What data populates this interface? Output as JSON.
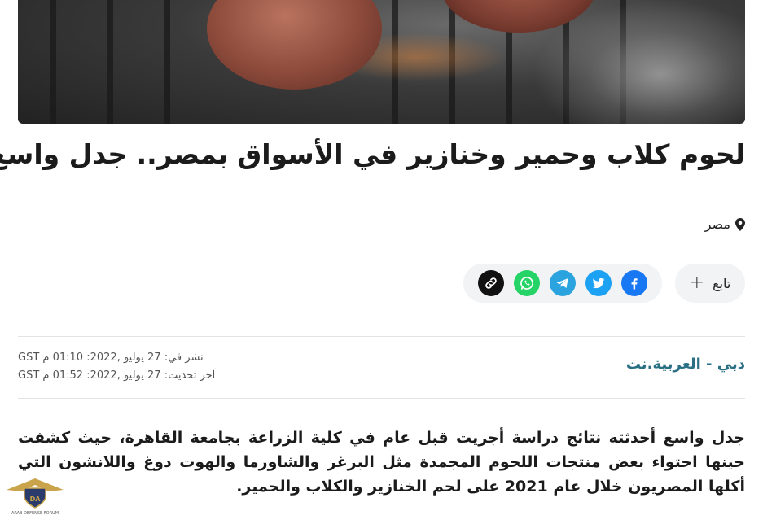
{
  "article": {
    "headline": "لحوم كلاب وحمير وخنازير في الأسواق بمصر.. جدل واسع",
    "location": "مصر",
    "source": "دبي - العربية.نت",
    "published": "نشر في: 27 يوليو ,2022: 01:10 م GST",
    "updated": "آخر تحديث: 27 يوليو ,2022: 01:52 م GST",
    "body": "جدل واسع أحدثته نتائج دراسة أجريت قبل عام في كلية الزراعة بجامعة القاهرة، حيث كشفت حينها احتواء بعض منتجات اللحوم المجمدة مثل البرغر والشاورما والهوت دوغ واللانشون التي أكلها المصريون خلال عام 2021 على لحم الخنازير والكلاب والحمير."
  },
  "actions": {
    "follow_label": "تابع"
  },
  "share": [
    {
      "name": "copy-link-icon",
      "color": "#111111"
    },
    {
      "name": "whatsapp-icon",
      "color": "#25d366"
    },
    {
      "name": "telegram-icon",
      "color": "#2aa3df"
    },
    {
      "name": "twitter-icon",
      "color": "#1da1f2"
    },
    {
      "name": "facebook-icon",
      "color": "#1877f2"
    }
  ],
  "icons": {
    "location": "map-pin-icon",
    "follow": "plus-icon"
  },
  "watermark": {
    "text": "ARAB DEFENSE FORUM"
  }
}
